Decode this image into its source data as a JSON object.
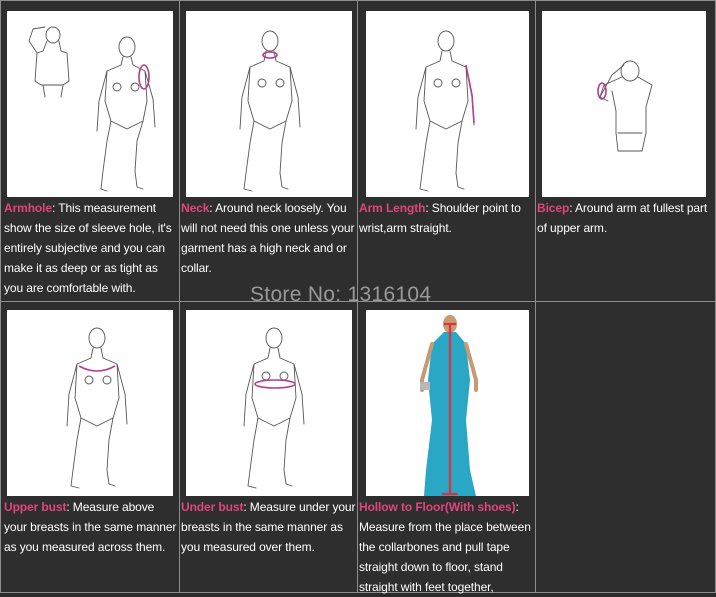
{
  "watermark": "Store No: 1316104",
  "colors": {
    "background": "#2b2b2b",
    "label": "#e0457d",
    "text": "#ffffff",
    "marker": "#b53c8e",
    "gown": "#2aa7c4",
    "tape": "#e0303a"
  },
  "items": [
    {
      "label": "Armhole",
      "text": ": This measurement show the size of sleeve hole, it's entirely subjective and you can make it as deep or as tight as you are comfortable with."
    },
    {
      "label": "Neck",
      "text": ": Around neck loosely. You will not need this one unless your garment has a high neck and or collar."
    },
    {
      "label": "Arm Length",
      "text": ": Shoulder point to wrist,arm straight."
    },
    {
      "label": "Bicep",
      "text": ": Around arm at fullest part of upper arm."
    },
    {
      "label": "Upper bust",
      "text": ": Measure above your breasts in the same manner as you measured across them."
    },
    {
      "label": "Under bust",
      "text": ": Measure under your breasts in the same manner as you measured over them."
    },
    {
      "label": "Hollow to Floor(With shoes)",
      "text": ": Measure from the place between the collarbones and pull tape straight down to floor, stand straight with feet together,"
    }
  ]
}
